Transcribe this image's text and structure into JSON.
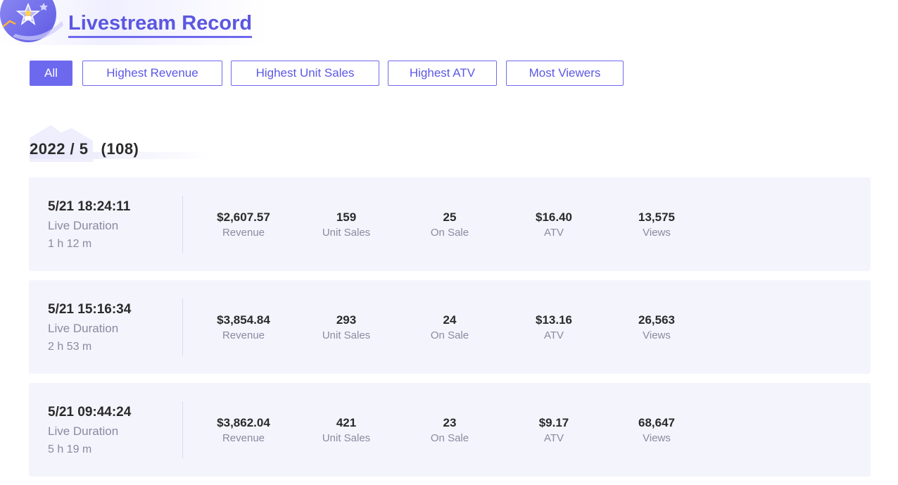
{
  "header": {
    "title": "Livestream Record",
    "logo_icon": "star-person-icon"
  },
  "filters": [
    {
      "label": "All",
      "active": true
    },
    {
      "label": "Highest Revenue",
      "active": false
    },
    {
      "label": "Highest Unit Sales",
      "active": false
    },
    {
      "label": "Highest ATV",
      "active": false
    },
    {
      "label": "Most Viewers",
      "active": false
    }
  ],
  "month": {
    "label": "2022 / 5",
    "count": "(108)"
  },
  "records": [
    {
      "time": "5/21 18:24:11",
      "duration_label": "Live Duration",
      "duration": "1 h 12 m",
      "metrics": [
        {
          "value": "$2,607.57",
          "label": "Revenue"
        },
        {
          "value": "159",
          "label": "Unit Sales"
        },
        {
          "value": "25",
          "label": "On Sale"
        },
        {
          "value": "$16.40",
          "label": "ATV"
        },
        {
          "value": "13,575",
          "label": "Views"
        }
      ]
    },
    {
      "time": "5/21 15:16:34",
      "duration_label": "Live Duration",
      "duration": "2 h 53 m",
      "metrics": [
        {
          "value": "$3,854.84",
          "label": "Revenue"
        },
        {
          "value": "293",
          "label": "Unit Sales"
        },
        {
          "value": "24",
          "label": "On Sale"
        },
        {
          "value": "$13.16",
          "label": "ATV"
        },
        {
          "value": "26,563",
          "label": "Views"
        }
      ]
    },
    {
      "time": "5/21 09:44:24",
      "duration_label": "Live Duration",
      "duration": "5 h 19 m",
      "metrics": [
        {
          "value": "$3,862.04",
          "label": "Revenue"
        },
        {
          "value": "421",
          "label": "Unit Sales"
        },
        {
          "value": "23",
          "label": "On Sale"
        },
        {
          "value": "$9.17",
          "label": "ATV"
        },
        {
          "value": "68,647",
          "label": "Views"
        }
      ]
    }
  ],
  "colors": {
    "accent": "#6d69ee",
    "title": "#5b57e0",
    "card_bg": "#f4f4fd",
    "muted_text": "#8a8aa0"
  }
}
